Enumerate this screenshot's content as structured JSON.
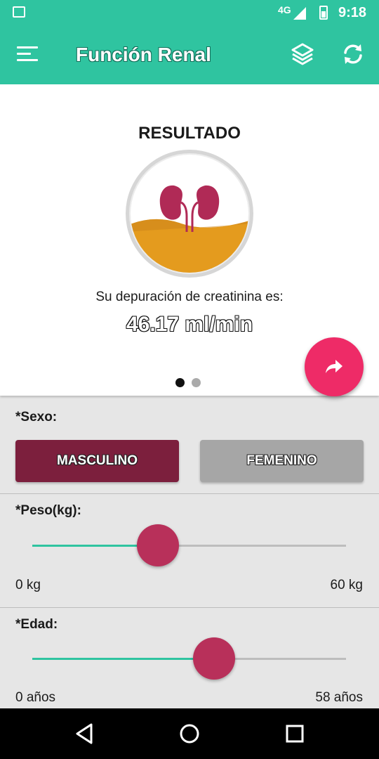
{
  "status_bar": {
    "network": "4G",
    "time": "9:18",
    "icons": [
      "image-notification-icon",
      "signal-icon",
      "battery-icon"
    ]
  },
  "app_bar": {
    "title": "Función Renal",
    "icons": [
      "menu-icon",
      "layers-icon",
      "refresh-icon"
    ]
  },
  "result": {
    "heading": "RESULTADO",
    "label": "Su depuración de creatinina es:",
    "value": "46.17 ml/min",
    "page_count": 2,
    "active_page": 1
  },
  "fab": {
    "icon": "share-icon"
  },
  "sex": {
    "label": "*Sexo:",
    "options": [
      "MASCULINO",
      "FEMENINO"
    ],
    "selected": "MASCULINO"
  },
  "weight": {
    "label": "*Peso(kg):",
    "min_label": "0 kg",
    "max_label": "60 kg",
    "fraction": 0.4
  },
  "age": {
    "label": "*Edad:",
    "min_label": "0 años",
    "max_label": "58 años",
    "fraction": 0.58
  },
  "colors": {
    "accent": "#2fc4a0",
    "primary_dark": "#7c1f3d",
    "thumb": "#b8305a",
    "fab": "#ee2b67",
    "inactive_button": "#a6a6a6"
  },
  "nav_bar": {
    "icons": [
      "back-icon",
      "home-icon",
      "recents-icon"
    ]
  }
}
